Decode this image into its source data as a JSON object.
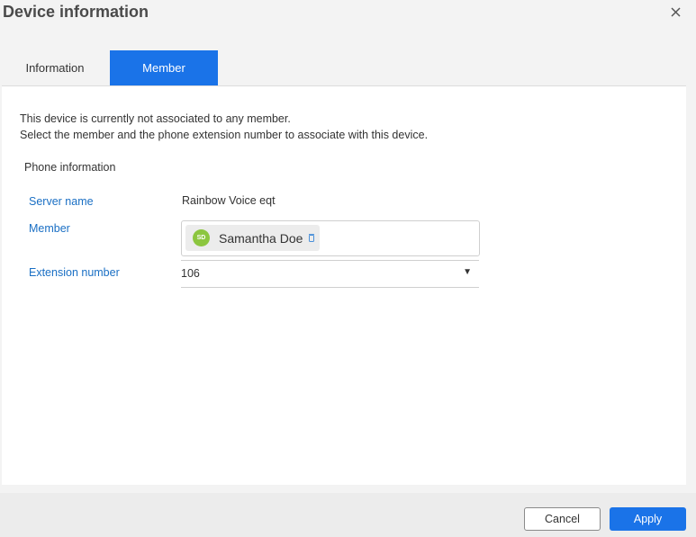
{
  "dialog": {
    "title": "Device information",
    "close_icon": "close-icon"
  },
  "tabs": [
    {
      "label": "Information",
      "active": false
    },
    {
      "label": "Member",
      "active": true
    }
  ],
  "message": {
    "line1": "This device is currently not associated to any member.",
    "line2": "Select the member and the phone extension number to associate with this device."
  },
  "phone_info": {
    "section_title": "Phone information",
    "server_name_label": "Server name",
    "server_name_value": "Rainbow Voice eqt",
    "member_label": "Member",
    "member": {
      "initials": "SD",
      "name": "Samantha Doe",
      "avatar_color": "#8cc63f",
      "remove_icon": "trash-icon"
    },
    "extension_label": "Extension number",
    "extension_value": "106"
  },
  "footer": {
    "cancel_label": "Cancel",
    "apply_label": "Apply"
  },
  "colors": {
    "accent": "#1a73e8",
    "label_blue": "#1a6fc4"
  }
}
